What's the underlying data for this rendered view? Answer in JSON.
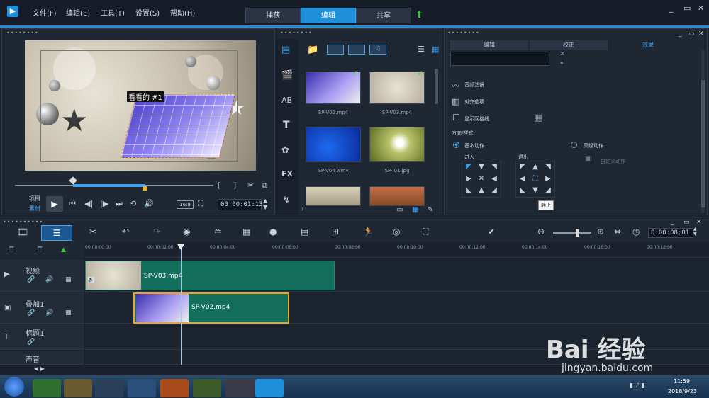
{
  "menu": [
    "文件(F)",
    "编辑(E)",
    "工具(T)",
    "设置(S)",
    "帮助(H)"
  ],
  "tabs": {
    "capture": "捕获",
    "edit": "编辑",
    "share": "共享"
  },
  "preview": {
    "title_text": "看看的 #1",
    "project_label": "项目",
    "clip_label": "素材",
    "aspect": "16:9",
    "timecode": "00:00:01:13"
  },
  "library": {
    "items": [
      {
        "name": "SP-V02.mp4"
      },
      {
        "name": "SP-V03.mp4"
      },
      {
        "name": "SP-V04.wmv"
      },
      {
        "name": "SP-I01.jpg"
      }
    ]
  },
  "options": {
    "tabs": [
      "编辑",
      "校正",
      "效果"
    ],
    "items": [
      "音频滤镜",
      "对齐选项",
      "显示网格线"
    ],
    "direction_label": "方向/样式:",
    "basic": "基本动作",
    "advanced": "高级动作",
    "custom": "自定义动作",
    "enter": "进入",
    "exit": "退出",
    "tooltip": "静止"
  },
  "timeline": {
    "timecode": "0:00:08:01",
    "ticks": [
      "00:00:00:00",
      "00:00:02:00",
      "00:00:04:00",
      "00:00:06:00",
      "00:00:08:00",
      "00:00:10:00",
      "00:00:12:00",
      "00:00:14:00",
      "00:00:16:00",
      "00:00:18:00"
    ],
    "tracks": [
      "视频",
      "叠加1",
      "标题1",
      "声音"
    ],
    "clips": [
      "SP-V03.mp4",
      "SP-V02.mp4"
    ]
  },
  "taskbar": {
    "time": "11:59",
    "date": "2018/9/23"
  },
  "watermark": {
    "logo": "Bai 经验",
    "url": "jingyan.baidu.com"
  },
  "colors": {
    "accent": "#1e8fd8",
    "clip": "#136f5c",
    "bg": "#1b2330"
  }
}
